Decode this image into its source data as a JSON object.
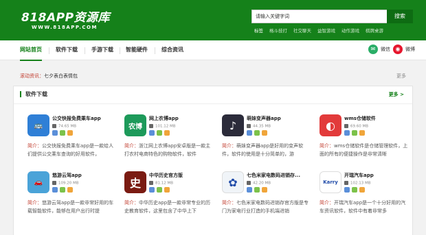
{
  "header": {
    "logo_text": "818APP资源库",
    "logo_sub": "WWW.818APP.COM",
    "search_placeholder": "请输入关键字词",
    "search_button": "搜索",
    "hot_label": "标签",
    "hot_tags": [
      "格斗技打",
      "社交聊天",
      "益智游戏",
      "动作游戏",
      "棋牌桌游"
    ]
  },
  "nav": {
    "items": [
      "网站首页",
      "软件下载",
      "手游下载",
      "智能硬件",
      "综合资讯"
    ],
    "wechat": "微信",
    "weibo": "微博"
  },
  "ticker": {
    "label": "滚动资讯：",
    "text": "七夕表白表情包",
    "more": "更多"
  },
  "panel": {
    "title": "软件下载",
    "more": "更多 >",
    "apps": [
      {
        "name": "公交快报免费乘车app",
        "size": "74.65 MB",
        "prefix": "简介：",
        "desc": "公交快报免费乘车app是一款给人们提供公交乘车查询的好用软件，",
        "icon_color": "#2f7fd6",
        "icon_glyph": "🚌"
      },
      {
        "name": "网上农博app",
        "size": "101.12 MB",
        "prefix": "简介：",
        "desc": "浙江网上农博app安卓版是一款主打农村电商特色的购物软件，软件",
        "icon_color": "#1d9a5a",
        "icon_glyph": "农博"
      },
      {
        "name": "萌妹变声器app",
        "size": "44.35 MB",
        "prefix": "简介：",
        "desc": "萌妹变声器app是好用的变声软件，软件的使用是十分简单的，游",
        "icon_color": "#2b2b3a",
        "icon_glyph": "♪"
      },
      {
        "name": "wms仓储软件",
        "size": "69.60 MB",
        "prefix": "简介：",
        "desc": "wms仓储软件是仓储管理软件，上面的所有的便捷操作是非常清晰",
        "icon_color": "#e23a3a",
        "icon_glyph": "◐"
      },
      {
        "name": "悠游云驾app",
        "size": "109.20 MB",
        "prefix": "简介：",
        "desc": "悠游云驾app是一款非常好用的车载智能软件，能够在用户出行时提",
        "icon_color": "#4aa3d8",
        "icon_glyph": "🚗"
      },
      {
        "name": "中华历史官方版",
        "size": "81.12 MB",
        "prefix": "简介：",
        "desc": "中华历史app是一款非常专业的历史教育软件，这里包含了中华上下",
        "icon_color": "#7a1b12",
        "icon_glyph": "史"
      },
      {
        "name": "七色米家电数码进销存...",
        "size": "42.20 MB",
        "prefix": "简介：",
        "desc": "七色米家电数码进销存官方版是专门为家电行业打造的手机端进销",
        "icon_color": "#f0f4f8",
        "icon_glyph": "✿"
      },
      {
        "name": "开瑞汽车app",
        "size": "102.13 MB",
        "prefix": "简介：",
        "desc": "开瑞汽车app是一个十分好用的汽车资讯软件，软件中有着非常多",
        "icon_color": "#ffffff",
        "icon_glyph": "Karry"
      }
    ]
  },
  "colors": {
    "brand_green": "#15811a",
    "accent_red": "#c0392b",
    "wechat_green": "#2aae67",
    "weibo_red": "#e6162d"
  }
}
